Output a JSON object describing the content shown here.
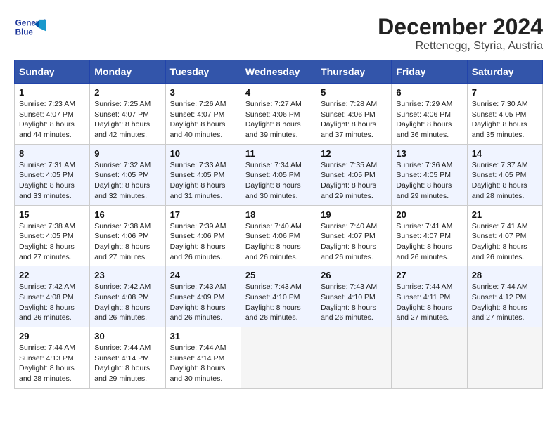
{
  "header": {
    "logo_line1": "General",
    "logo_line2": "Blue",
    "title": "December 2024",
    "subtitle": "Rettenegg, Styria, Austria"
  },
  "calendar": {
    "days_of_week": [
      "Sunday",
      "Monday",
      "Tuesday",
      "Wednesday",
      "Thursday",
      "Friday",
      "Saturday"
    ],
    "weeks": [
      [
        null,
        null,
        {
          "day": 1,
          "sunrise": "7:23 AM",
          "sunset": "4:07 PM",
          "daylight": "8 hours and 44 minutes."
        },
        {
          "day": 2,
          "sunrise": "7:25 AM",
          "sunset": "4:07 PM",
          "daylight": "8 hours and 42 minutes."
        },
        {
          "day": 3,
          "sunrise": "7:26 AM",
          "sunset": "4:07 PM",
          "daylight": "8 hours and 40 minutes."
        },
        {
          "day": 4,
          "sunrise": "7:27 AM",
          "sunset": "4:06 PM",
          "daylight": "8 hours and 39 minutes."
        },
        {
          "day": 5,
          "sunrise": "7:28 AM",
          "sunset": "4:06 PM",
          "daylight": "8 hours and 37 minutes."
        },
        {
          "day": 6,
          "sunrise": "7:29 AM",
          "sunset": "4:06 PM",
          "daylight": "8 hours and 36 minutes."
        },
        {
          "day": 7,
          "sunrise": "7:30 AM",
          "sunset": "4:05 PM",
          "daylight": "8 hours and 35 minutes."
        }
      ],
      [
        {
          "day": 8,
          "sunrise": "7:31 AM",
          "sunset": "4:05 PM",
          "daylight": "8 hours and 33 minutes."
        },
        {
          "day": 9,
          "sunrise": "7:32 AM",
          "sunset": "4:05 PM",
          "daylight": "8 hours and 32 minutes."
        },
        {
          "day": 10,
          "sunrise": "7:33 AM",
          "sunset": "4:05 PM",
          "daylight": "8 hours and 31 minutes."
        },
        {
          "day": 11,
          "sunrise": "7:34 AM",
          "sunset": "4:05 PM",
          "daylight": "8 hours and 30 minutes."
        },
        {
          "day": 12,
          "sunrise": "7:35 AM",
          "sunset": "4:05 PM",
          "daylight": "8 hours and 29 minutes."
        },
        {
          "day": 13,
          "sunrise": "7:36 AM",
          "sunset": "4:05 PM",
          "daylight": "8 hours and 29 minutes."
        },
        {
          "day": 14,
          "sunrise": "7:37 AM",
          "sunset": "4:05 PM",
          "daylight": "8 hours and 28 minutes."
        }
      ],
      [
        {
          "day": 15,
          "sunrise": "7:38 AM",
          "sunset": "4:05 PM",
          "daylight": "8 hours and 27 minutes."
        },
        {
          "day": 16,
          "sunrise": "7:38 AM",
          "sunset": "4:06 PM",
          "daylight": "8 hours and 27 minutes."
        },
        {
          "day": 17,
          "sunrise": "7:39 AM",
          "sunset": "4:06 PM",
          "daylight": "8 hours and 26 minutes."
        },
        {
          "day": 18,
          "sunrise": "7:40 AM",
          "sunset": "4:06 PM",
          "daylight": "8 hours and 26 minutes."
        },
        {
          "day": 19,
          "sunrise": "7:40 AM",
          "sunset": "4:07 PM",
          "daylight": "8 hours and 26 minutes."
        },
        {
          "day": 20,
          "sunrise": "7:41 AM",
          "sunset": "4:07 PM",
          "daylight": "8 hours and 26 minutes."
        },
        {
          "day": 21,
          "sunrise": "7:41 AM",
          "sunset": "4:07 PM",
          "daylight": "8 hours and 26 minutes."
        }
      ],
      [
        {
          "day": 22,
          "sunrise": "7:42 AM",
          "sunset": "4:08 PM",
          "daylight": "8 hours and 26 minutes."
        },
        {
          "day": 23,
          "sunrise": "7:42 AM",
          "sunset": "4:08 PM",
          "daylight": "8 hours and 26 minutes."
        },
        {
          "day": 24,
          "sunrise": "7:43 AM",
          "sunset": "4:09 PM",
          "daylight": "8 hours and 26 minutes."
        },
        {
          "day": 25,
          "sunrise": "7:43 AM",
          "sunset": "4:10 PM",
          "daylight": "8 hours and 26 minutes."
        },
        {
          "day": 26,
          "sunrise": "7:43 AM",
          "sunset": "4:10 PM",
          "daylight": "8 hours and 26 minutes."
        },
        {
          "day": 27,
          "sunrise": "7:44 AM",
          "sunset": "4:11 PM",
          "daylight": "8 hours and 27 minutes."
        },
        {
          "day": 28,
          "sunrise": "7:44 AM",
          "sunset": "4:12 PM",
          "daylight": "8 hours and 27 minutes."
        }
      ],
      [
        {
          "day": 29,
          "sunrise": "7:44 AM",
          "sunset": "4:13 PM",
          "daylight": "8 hours and 28 minutes."
        },
        {
          "day": 30,
          "sunrise": "7:44 AM",
          "sunset": "4:14 PM",
          "daylight": "8 hours and 29 minutes."
        },
        {
          "day": 31,
          "sunrise": "7:44 AM",
          "sunset": "4:14 PM",
          "daylight": "8 hours and 30 minutes."
        },
        null,
        null,
        null,
        null
      ]
    ]
  }
}
